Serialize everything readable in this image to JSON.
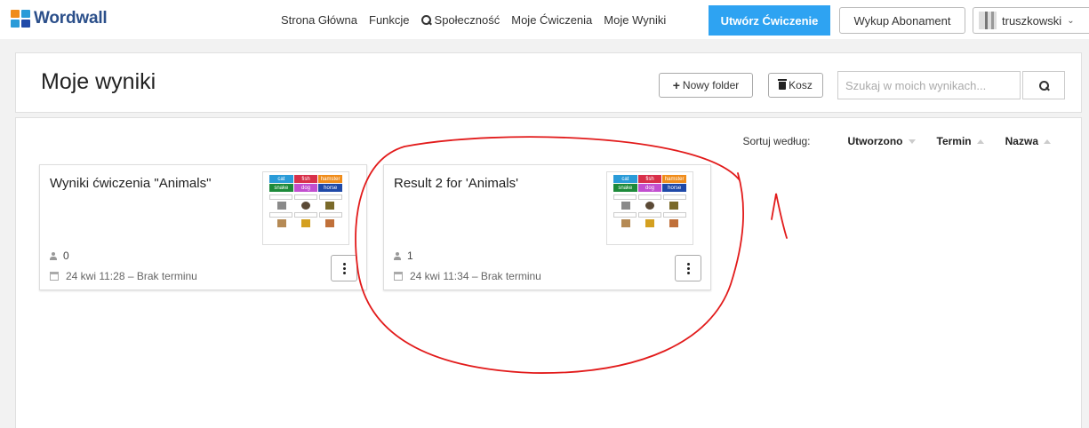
{
  "header": {
    "logo": "Wordwall",
    "nav": [
      "Strona Główna",
      "Funkcje",
      "Społeczność",
      "Moje Ćwiczenia",
      "Moje Wyniki"
    ],
    "create_label": "Utwórz Ćwiczenie",
    "subscribe_label": "Wykup Abonament",
    "user_name": "truszkowski"
  },
  "page": {
    "title": "Moje wyniki",
    "new_folder_label": "Nowy folder",
    "trash_label": "Kosz",
    "search_placeholder": "Szukaj w moich wynikach..."
  },
  "sort": {
    "label": "Sortuj według:",
    "options": [
      "Utworzono",
      "Termin",
      "Nazwa"
    ]
  },
  "thumbnail_words": [
    {
      "text": "cat",
      "color": "#2a9bd8"
    },
    {
      "text": "fish",
      "color": "#d8304a"
    },
    {
      "text": "hamster",
      "color": "#f08c1a"
    },
    {
      "text": "snake",
      "color": "#1d8a3a"
    },
    {
      "text": "dog",
      "color": "#c24fcf"
    },
    {
      "text": "horse",
      "color": "#1f49a8"
    }
  ],
  "cards": [
    {
      "title": "Wyniki ćwiczenia \"Animals\"",
      "count": "0",
      "date": "24 kwi 11:28 – Brak terminu"
    },
    {
      "title": "Result 2 for 'Animals'",
      "count": "1",
      "date": "24 kwi 11:34 – Brak terminu"
    }
  ],
  "colors": {
    "accent": "#2ea3f2",
    "logo_blue": "#2b4f8a",
    "annotation": "#e21b1b"
  }
}
